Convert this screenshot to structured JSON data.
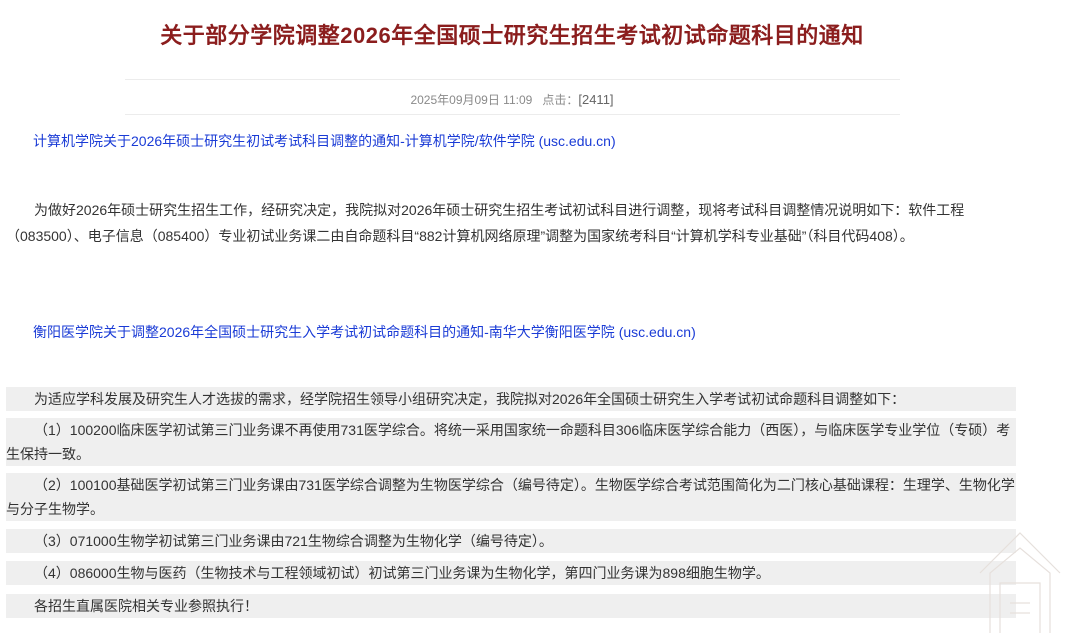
{
  "article": {
    "title": "关于部分学院调整2026年全国硕士研究生招生考试初试命题科目的通知",
    "date": "2025年09月09日 11:09",
    "clicks_label": "点击：",
    "clicks_value": "[2411]"
  },
  "section1": {
    "link": "计算机学院关于2026年硕士研究生初试考试科目调整的通知-计算机学院/软件学院 (usc.edu.cn)",
    "paragraph": "为做好2026年硕士研究生招生工作，经研究决定，我院拟对2026年硕士研究生招生考试初试科目进行调整，现将考试科目调整情况说明如下：软件工程（083500）、电子信息（085400）专业初试业务课二由自命题科目“882计算机网络原理”调整为国家统考科目“计算机学科专业基础”（科目代码408）。"
  },
  "section2": {
    "link": "衡阳医学院关于调整2026年全国硕士研究生入学考试初试命题科目的通知-南华大学衡阳医学院 (usc.edu.cn)",
    "intro": "为适应学科发展及研究生人才选拔的需求，经学院招生领导小组研究决定，我院拟对2026年全国硕士研究生入学考试初试命题科目调整如下：",
    "items": [
      "（1）100200临床医学初试第三门业务课不再使用731医学综合。将统一采用国家统一命题科目306临床医学综合能力（西医），与临床医学专业学位（专硕）考生保持一致。",
      "（2）100100基础医学初试第三门业务课由731医学综合调整为生物医学综合（编号待定）。生物医学综合考试范围简化为二门核心基础课程：生理学、生物化学与分子生物学。",
      "（3）071000生物学初试第三门业务课由721生物综合调整为生物化学（编号待定）。",
      "（4）086000生物与医药（生物技术与工程领域初试）初试第三门业务课为生物化学，第四门业务课为898细胞生物学。"
    ],
    "closing": "各招生直属医院相关专业参照执行！"
  }
}
